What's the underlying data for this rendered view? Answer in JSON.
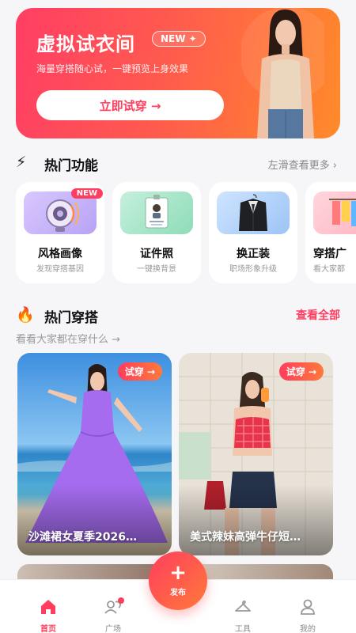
{
  "hero": {
    "title": "虚拟试衣间",
    "badge": "NEW ✦",
    "subtitle": "海量穿搭随心试，一键预览上身效果",
    "cta": "立即试穿 →"
  },
  "features_section": {
    "icon": "⚡",
    "title": "热门功能",
    "more": "左滑查看更多 ›",
    "cards": [
      {
        "label": "风格画像",
        "desc": "发现穿搭基因",
        "badge": "NEW",
        "icon": "speaker-icon"
      },
      {
        "label": "证件照",
        "desc": "一键换背景",
        "icon": "id-card-icon"
      },
      {
        "label": "换正装",
        "desc": "职场形象升级",
        "icon": "suit-jacket-icon"
      },
      {
        "label": "穿搭广",
        "desc": "看大家都",
        "icon": "clothes-rack-icon"
      }
    ]
  },
  "outfits_section": {
    "icon": "🔥",
    "title": "热门穿搭",
    "more": "查看全部",
    "subtitle": "看看大家都在穿什么 →",
    "cards": [
      {
        "title": "沙滩裙女夏季2026…",
        "try_label": "试穿 →"
      },
      {
        "title": "美式辣妹高弹牛仔短…",
        "try_label": "试穿 →"
      }
    ]
  },
  "bottom_nav": {
    "items": [
      {
        "label": "首页",
        "icon": "home-icon",
        "active": true
      },
      {
        "label": "广场",
        "icon": "community-icon",
        "dot": true
      },
      {
        "label": "工具",
        "icon": "hanger-icon"
      },
      {
        "label": "我的",
        "icon": "profile-icon"
      }
    ],
    "fab": {
      "plus": "+",
      "label": "发布"
    }
  },
  "colors": {
    "accent": "#ff3d5e",
    "accent_orange": "#ff7a3a",
    "background": "#f6f6f8"
  }
}
